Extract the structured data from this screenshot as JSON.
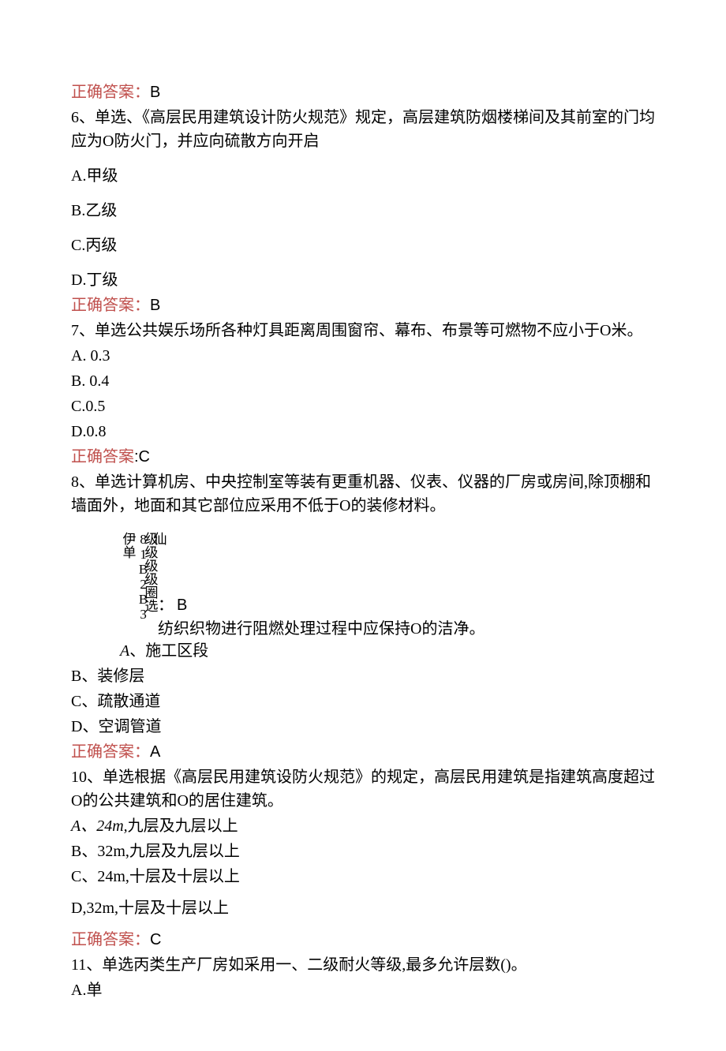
{
  "labels": {
    "correct_answer": "正确答案"
  },
  "q5": {
    "answer": "B"
  },
  "q6": {
    "stem": "6、单选、《高层民用建筑设计防火规范》规定，高层建筑防烟楼梯间及其前室的门均应为O防火门，并应向硫散方向开启",
    "A": "A.甲级",
    "B": "B.乙级",
    "C": "C.丙级",
    "D": "D.丁级",
    "answer": "B"
  },
  "q7": {
    "stem": "7、单选公共娱乐场所各种灯具距离周围窗帘、幕布、布景等可燃物不应小于O米。",
    "A": "A.  0.3",
    "B": "B.  0.4",
    "C": "C.0.5",
    "D": "D.0.8",
    "answer": ":C"
  },
  "q8": {
    "stem": "8、单选计算机房、中央控制室等装有更重机器、仪表、仪器的厂房或房间,除顶棚和墙面外，地面和其它部位应采用不低于O的装修材料。",
    "vert_left": "仙81B2B3伊单",
    "vert_right": "级级级级圈选",
    "ans_colon": "：",
    "ans_val": "B",
    "q9_tail": "纺织织物进行阻燃处理过程中应保持O的洁净。"
  },
  "q9": {
    "A_prefix": "A",
    "A_text": "、施工区段",
    "B": "B、装修层",
    "C": "C、疏散通道",
    "D": "D、空调管道",
    "answer": "A"
  },
  "q10": {
    "stem": "10、单选根据《高层民用建筑设防火规范》的规定，高层民用建筑是指建筑高度超过O的公共建筑和O的居住建筑。",
    "A_prefix": "A",
    "A_text": "、24m,",
    "A_tail": "九层及九层以上",
    "B": "B、32m,九层及九层以上",
    "C": "C、24m,十层及十层以上",
    "D": "D,32m,十层及十层以上",
    "answer": "C"
  },
  "q11": {
    "stem": "11、单选丙类生产厂房如采用一、二级耐火等级,最多允许层数()。",
    "A": "A.单"
  }
}
